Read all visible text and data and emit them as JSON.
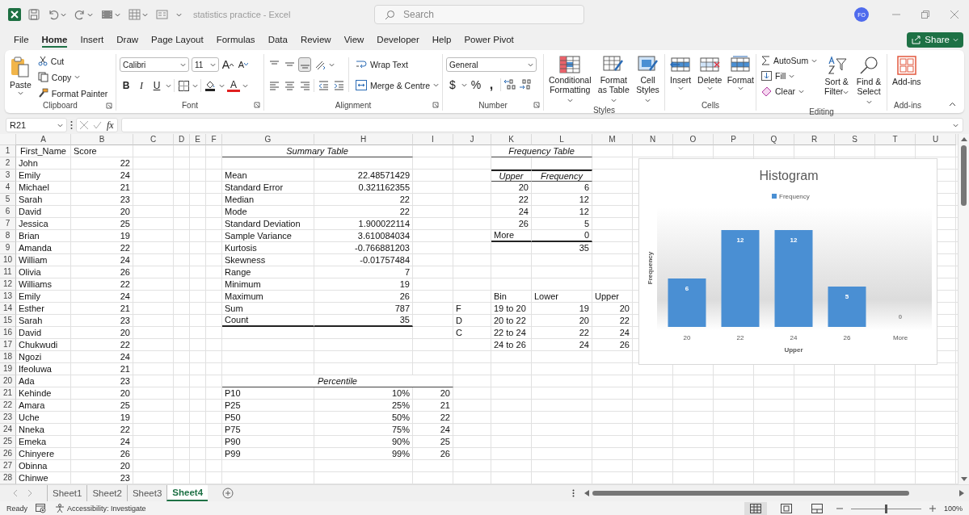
{
  "title_bar": {
    "title": "statistics practice - Excel",
    "search_placeholder": "Search",
    "avatar": "FO"
  },
  "menu_tabs": [
    {
      "label": "File",
      "selected": false
    },
    {
      "label": "Home",
      "selected": true
    },
    {
      "label": "Insert",
      "selected": false
    },
    {
      "label": "Draw",
      "selected": false
    },
    {
      "label": "Page Layout",
      "selected": false
    },
    {
      "label": "Formulas",
      "selected": false
    },
    {
      "label": "Data",
      "selected": false
    },
    {
      "label": "Review",
      "selected": false
    },
    {
      "label": "View",
      "selected": false
    },
    {
      "label": "Developer",
      "selected": false
    },
    {
      "label": "Help",
      "selected": false
    },
    {
      "label": "Power Pivot",
      "selected": false
    }
  ],
  "share": "Share",
  "ribbon": {
    "groups": [
      {
        "kind": "clipboard",
        "label": "Clipboard",
        "launcher": true,
        "items": [
          "Paste",
          "Cut",
          "Copy",
          "Format Painter"
        ]
      },
      {
        "kind": "font",
        "label": "Font",
        "launcher": true,
        "font": "Calibri",
        "size": "11",
        "grow": "A",
        "shrink": "A",
        "styles": [
          "B",
          "I",
          "U"
        ],
        "font_color": "A"
      },
      {
        "kind": "alignment",
        "label": "Alignment",
        "launcher": true,
        "vertical": [
          {
            "selected": false
          },
          {
            "selected": false
          },
          {
            "selected": true
          }
        ],
        "wrap": "Wrap Text",
        "merge": "Merge & Centre"
      },
      {
        "kind": "number",
        "label": "Number",
        "launcher": true,
        "format": "General",
        "currency": "$",
        "percent": "%",
        "comma": ","
      },
      {
        "kind": "styles",
        "label": "Styles",
        "items": [
          "Conditional Formatting",
          "Format as Table",
          "Cell Styles"
        ]
      },
      {
        "kind": "cells",
        "label": "Cells",
        "items": [
          "Insert",
          "Delete",
          "Format"
        ]
      },
      {
        "kind": "editing",
        "label": "Editing",
        "items": [
          "AutoSum",
          "Fill",
          "Clear",
          "Sort & Filter",
          "Find & Select"
        ]
      },
      {
        "kind": "addins",
        "label": "Add-ins",
        "items": [
          "Add-ins"
        ]
      }
    ]
  },
  "formula_bar": {
    "name_box": "R21",
    "fx": "fx"
  },
  "sheet": {
    "columns": [
      "A",
      "B",
      "C",
      "D",
      "E",
      "F",
      "G",
      "H",
      "I",
      "J",
      "K",
      "L",
      "M",
      "N",
      "O",
      "P",
      "Q",
      "R",
      "S",
      "T",
      "U"
    ],
    "row_numbers": [
      "1",
      "2",
      "3",
      "4",
      "5",
      "6",
      "7",
      "8",
      "9",
      "10",
      "11",
      "12",
      "13",
      "14",
      "15",
      "16",
      "17",
      "18",
      "19",
      "20",
      "21",
      "22",
      "23",
      "24",
      "25",
      "26",
      "27",
      "28"
    ],
    "scores": {
      "headers": [
        "First_Name",
        "Score"
      ],
      "rows": [
        {
          "name": "John",
          "score": "22"
        },
        {
          "name": "Emily",
          "score": "24"
        },
        {
          "name": "Michael",
          "score": "21"
        },
        {
          "name": "Sarah",
          "score": "23"
        },
        {
          "name": "David",
          "score": "20"
        },
        {
          "name": "Jessica",
          "score": "25"
        },
        {
          "name": "Brian",
          "score": "19"
        },
        {
          "name": "Amanda",
          "score": "22"
        },
        {
          "name": "William",
          "score": "24"
        },
        {
          "name": "Olivia",
          "score": "26"
        },
        {
          "name": "Williams",
          "score": "22"
        },
        {
          "name": "Emily",
          "score": "24"
        },
        {
          "name": "Esther",
          "score": "21"
        },
        {
          "name": "Sarah",
          "score": "23"
        },
        {
          "name": "David",
          "score": "20"
        },
        {
          "name": "Chukwudi",
          "score": "22"
        },
        {
          "name": "Ngozi",
          "score": "24"
        },
        {
          "name": "Ifeoluwa",
          "score": "21"
        },
        {
          "name": "Ada",
          "score": "23"
        },
        {
          "name": "Kehinde",
          "score": "20"
        },
        {
          "name": "Amara",
          "score": "25"
        },
        {
          "name": "Uche",
          "score": "19"
        },
        {
          "name": "Nneka",
          "score": "22"
        },
        {
          "name": "Emeka",
          "score": "24"
        },
        {
          "name": "Chinyere",
          "score": "26"
        },
        {
          "name": "Obinna",
          "score": "20"
        },
        {
          "name": "Chinwe",
          "score": "23"
        }
      ]
    },
    "summary": {
      "title": "Summary Table",
      "rows": [
        {
          "label": "Mean",
          "value": "22.48571429"
        },
        {
          "label": "Standard Error",
          "value": "0.321162355"
        },
        {
          "label": "Median",
          "value": "22"
        },
        {
          "label": "Mode",
          "value": "22"
        },
        {
          "label": "Standard Deviation",
          "value": "1.900022114"
        },
        {
          "label": "Sample Variance",
          "value": "3.610084034"
        },
        {
          "label": "Kurtosis",
          "value": "-0.766881203"
        },
        {
          "label": "Skewness",
          "value": "-0.01757484"
        },
        {
          "label": "Range",
          "value": "7"
        },
        {
          "label": "Minimum",
          "value": "19"
        },
        {
          "label": "Maximum",
          "value": "26"
        },
        {
          "label": "Sum",
          "value": "787"
        },
        {
          "label": "Count",
          "value": "35"
        }
      ]
    },
    "frequency": {
      "title": "Frequency Table",
      "headers": [
        "Upper",
        "Frequency"
      ],
      "rows": [
        {
          "upper": "20",
          "frequency": "6",
          "kind": "bin"
        },
        {
          "upper": "22",
          "frequency": "12",
          "kind": "bin"
        },
        {
          "upper": "24",
          "frequency": "12",
          "kind": "bin"
        },
        {
          "upper": "26",
          "frequency": "5",
          "kind": "bin"
        },
        {
          "upper": "More",
          "frequency": "0",
          "kind": "overflow"
        }
      ],
      "total": "35"
    },
    "bins": {
      "headers": [
        "Bin",
        "Lower",
        "Upper"
      ],
      "rows": [
        {
          "bin": "19 to 20",
          "lower": "19",
          "upper": "20"
        },
        {
          "bin": "20 to 22",
          "lower": "20",
          "upper": "22"
        },
        {
          "bin": "22 to 24",
          "lower": "22",
          "upper": "24"
        },
        {
          "bin": "24 to 26",
          "lower": "24",
          "upper": "26"
        }
      ]
    },
    "grades": [
      "F",
      "D",
      "C"
    ],
    "percentile": {
      "title": "Percentile",
      "rows": [
        {
          "label": "P10",
          "percent": "10%",
          "value": "20"
        },
        {
          "label": "P25",
          "percent": "25%",
          "value": "21"
        },
        {
          "label": "P50",
          "percent": "50%",
          "value": "22"
        },
        {
          "label": "P75",
          "percent": "75%",
          "value": "24"
        },
        {
          "label": "P90",
          "percent": "90%",
          "value": "25"
        },
        {
          "label": "P99",
          "percent": "99%",
          "value": "26"
        }
      ]
    },
    "chart": {
      "chart_data": {
        "type": "bar",
        "title": "Histogram",
        "xlabel": "Upper",
        "ylabel": "Frequency",
        "categories": [
          "20",
          "22",
          "24",
          "26",
          "More"
        ],
        "series": [
          {
            "name": "Frequency",
            "color": "#4a8fd3",
            "values": [
              6,
              12,
              12,
              5,
              0
            ]
          }
        ],
        "data_labels": true
      }
    }
  },
  "sheet_tabs": [
    {
      "label": "Sheet1",
      "selected": false
    },
    {
      "label": "Sheet2",
      "selected": false
    },
    {
      "label": "Sheet3",
      "selected": false
    },
    {
      "label": "Sheet4",
      "selected": true
    }
  ],
  "status_bar": {
    "status": "Ready",
    "accessibility": "Accessibility: Investigate",
    "views": [
      {
        "selected": true
      },
      {
        "selected": false
      },
      {
        "selected": false
      }
    ],
    "zoom": {
      "level": 0.5,
      "reading": "100%"
    }
  }
}
